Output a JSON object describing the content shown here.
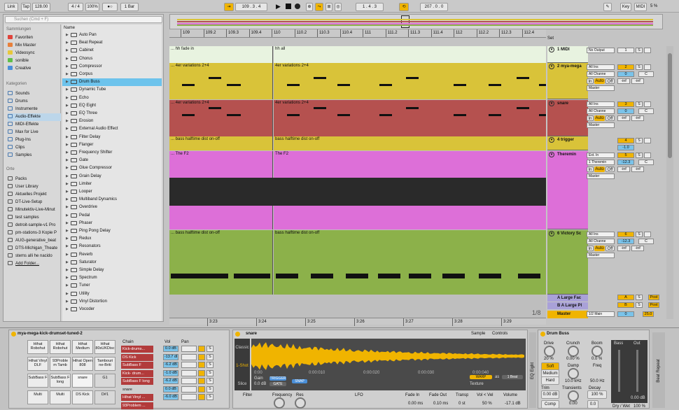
{
  "transport": {
    "link": "Link",
    "tap": "Tap",
    "tempo": "128.00",
    "signature": "4 / 4",
    "zoom": "100%",
    "metronome": "●○",
    "quantize": "1 Bar",
    "position": "109 .  3 .  4",
    "loop_start": "1 .  4 .  3",
    "loop_length": "207 .  0 .  0",
    "key": "Key",
    "midi": "MIDI",
    "cpu": "5 %"
  },
  "browser": {
    "search_placeholder": "Suchen (Cmd + F)",
    "collections_header": "Sammlungen",
    "collections": [
      {
        "label": "Favoriten",
        "color": "#e0433b"
      },
      {
        "label": "Mix Master",
        "color": "#e8803a"
      },
      {
        "label": "Videosync",
        "color": "#e7c83b"
      },
      {
        "label": "sonible",
        "color": "#5fbf4a"
      },
      {
        "label": "Creative",
        "color": "#4a8fd8"
      }
    ],
    "categories_header": "Kategorien",
    "categories": [
      "Sounds",
      "Drums",
      "Instrumente",
      "Audio-Effekte",
      "MIDI-Effekte",
      "Max for Live",
      "Plug-Ins",
      "Clips",
      "Samples"
    ],
    "places_header": "Orte",
    "places": [
      "Packs",
      "User Library",
      "Aktuelles Projekt",
      "DT-Live-Setup",
      "Minutektiv-Live-Minut",
      "test samples",
      "detroit-sample-v1 Pro",
      "pm-stations-3 Kopie P",
      "AUG-generative_beat",
      "DTS-Michigan_Theate",
      "stems alli he nacido",
      "Add Folder..."
    ],
    "name_header": "Name",
    "devices": [
      "Auto Pan",
      "Beat Repeat",
      "Cabinet",
      "Chorus",
      "Compressor",
      "Corpus",
      "Drum Buss",
      "Dynamic Tube",
      "Echo",
      "EQ Eight",
      "EQ Three",
      "Erosion",
      "External Audio Effect",
      "Filter Delay",
      "Flanger",
      "Frequency Shifter",
      "Gate",
      "Glue Compressor",
      "Grain Delay",
      "Limiter",
      "Looper",
      "Multiband Dynamics",
      "Overdrive",
      "Pedal",
      "Phaser",
      "Ping Pong Delay",
      "Redux",
      "Resonators",
      "Reverb",
      "Saturator",
      "Simple Delay",
      "Spectrum",
      "Tuner",
      "Utility",
      "Vinyl Distortion",
      "Vocoder"
    ],
    "selected": "Drum Buss"
  },
  "ruler": [
    "109",
    "109.2",
    "109.3",
    "109.4",
    "110",
    "110.2",
    "110.3",
    "110.4",
    "111",
    "111.2",
    "111.3",
    "111.4",
    "112",
    "112.2",
    "112.3",
    "112.4"
  ],
  "time_ruler": [
    "3:23",
    "3:24",
    "3:25",
    "3:26",
    "3:27",
    "3:28",
    "3:29"
  ],
  "set_label": "Set",
  "zoom_ratio": "1/8",
  "tracks": [
    {
      "number": "1",
      "name": "1 MIDI",
      "clip_a": "... hh fade in",
      "clip_b": "hh all",
      "color": "#e8f3e0",
      "io": "No Output"
    },
    {
      "number": "2",
      "name": "2 mya-mega",
      "clip_a": "... 4er variations 2+4",
      "clip_b": "4er variations 2+4",
      "color": "#d9c339",
      "io": "All Ins",
      "chan": "All Channe",
      "vol": "0",
      "pan": "C"
    },
    {
      "number": "3",
      "name": "snare",
      "clip_a": "... 4er variations 2+4",
      "clip_b": "4er variations 2+4",
      "color": "#b5514f",
      "io": "All Ins",
      "chan": "All Channe",
      "vol": "0",
      "pan": "C"
    },
    {
      "number": "4",
      "name": "4 trigger",
      "clip_a": "... bass halftime dist on-off",
      "clip_b": "bass halftime dist on-off",
      "color": "#d9c339",
      "vol": "-1.0"
    },
    {
      "number": "5",
      "name": "Theremin",
      "clip_a": "... The F2",
      "clip_b": "The F2",
      "color": "#dd6fd8",
      "io": "Ext. In",
      "chan": "1 Theremin",
      "vol": "-12.3",
      "pan": "C"
    },
    {
      "number": "6",
      "name": "6 Victory Sc",
      "clip_a": "... bass halftime dist on-off",
      "clip_b": "bass halftime dist on-off",
      "color": "#8cb14a",
      "io": "All Ins",
      "chan": "All Channe",
      "vol": "-12.3",
      "pan": "C"
    }
  ],
  "returns": [
    {
      "letter": "A",
      "name": "A Large Fac"
    },
    {
      "letter": "B",
      "name": "B A Large Pl"
    }
  ],
  "master": {
    "name": "Master",
    "io": "1/2 Main",
    "vol": "0",
    "db": "25.0"
  },
  "mixer_labels": {
    "in": "In",
    "auto": "Auto",
    "off": "Off",
    "master": "Master",
    "inf": "-inf",
    "s": "S",
    "post": "Post"
  },
  "drum_rack": {
    "title": "mya-mega-kick-drumset-tuned-2",
    "pads": [
      [
        "Hihat Robohut",
        "Hihat Robohut",
        "Hihat Medium",
        "Hihat 80sUKDisc"
      ],
      [
        "Hihat Vinyl DLF",
        "93Proble m Tamb",
        "Hihat Open 808",
        "Tambouri ne-Briti"
      ],
      [
        "SubBass F",
        "SubBass F long",
        "snare",
        "G1"
      ],
      [
        "Multi",
        "Multi",
        "DS Kick",
        "D#1"
      ]
    ],
    "chain_header": "Chain",
    "vol_header": "Vol",
    "pan_header": "Pan",
    "chains": [
      {
        "name": "Kick-drums...",
        "vol": "0.0 dB",
        "color": "#b23b3b"
      },
      {
        "name": "DS Kick",
        "vol": "-13.7 dl",
        "color": "#b23b3b"
      },
      {
        "name": "SubBass F",
        "vol": "-6.2 dB",
        "color": "#b23b3b"
      },
      {
        "name": "Kick- drum...",
        "vol": "-1.0 dB",
        "color": "#b23b3b"
      },
      {
        "name": "SubBass F long",
        "vol": "-6.2 dB",
        "color": "#b23b3b"
      },
      {
        "name": "snare",
        "vol": "0.0 dB",
        "color": "#cfcfcf"
      },
      {
        "name": "Hihat Vinyl ...",
        "vol": "-6.0 dB",
        "color": "#b23b3b"
      },
      {
        "name": "93Problem ...",
        "vol": "",
        "color": "#b23b3b"
      }
    ]
  },
  "simpler": {
    "title": "snare",
    "tab_sample": "Sample",
    "tab_controls": "Controls",
    "modes": [
      "Classic",
      "1-Shot",
      "Slice"
    ],
    "gain_label": "Gain",
    "gain_value": "0.0 dB",
    "trigger": "TRIGGER",
    "gate": "GATE",
    "snap": "SNAP",
    "warp": "WARP",
    "as": "as",
    "beat": "1 Beat",
    "texture": "Texture",
    "time_marks": [
      "0:00",
      "0:00:010",
      "0:00:020",
      "0:00:030",
      "0:00:040"
    ],
    "filter": "Filter",
    "frequency": "Frequency",
    "res": "Res",
    "lfo": "LFO",
    "fade_in_label": "Fade In",
    "fade_in": "0.00 ms",
    "fade_out_label": "Fade Out",
    "fade_out": "0.10 ms",
    "transp_label": "Transp",
    "transp": "0 st",
    "vol_vel_label": "Vol < Vel",
    "vol_vel": "50 %",
    "volume_label": "Volume",
    "volume": "-17.1 dB"
  },
  "eq_label": "EQ Eight",
  "drum_buss": {
    "title": "Drum Buss",
    "drive_label": "Drive",
    "drive": "20 %",
    "crunch_label": "Crunch",
    "crunch": "0.00 %",
    "boom_label": "Boom",
    "boom": "0.0 %",
    "soft": "Soft",
    "medium": "Medium",
    "hard": "Hard",
    "damp_label": "Damp",
    "damp": "10.0 kHz",
    "freq_label": "Freq",
    "freq": "50.0 Hz",
    "trim_label": "Trim",
    "trim": "0.00 dB",
    "transients_label": "Transients",
    "transients": "0.00",
    "decay_label": "Decay",
    "decay": "100 %",
    "comp": "Comp",
    "bass_label": "Bass",
    "out_label": "Out",
    "out": "0.00 dB",
    "dry_wet": "Dry / Wet",
    "dry_wet_value": "100 %",
    "zero": "0.0"
  },
  "beat_repeat": "Beat Repeat"
}
